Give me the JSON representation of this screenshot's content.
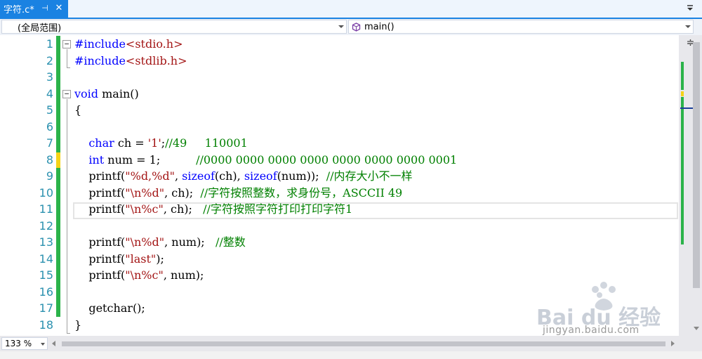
{
  "tab": {
    "title": "字符.c*",
    "pin_glyph": "⊣",
    "close_glyph": "✕"
  },
  "navbar": {
    "scope": "(全局范围)",
    "member": "main()"
  },
  "zoom": "133 %",
  "watermark": {
    "brand": "Bai du 经验",
    "url": "jingyan.baidu.com"
  },
  "lines": [
    {
      "n": "1",
      "segments": [
        {
          "t": "#include",
          "c": "kw"
        },
        {
          "t": "<stdio.h>",
          "c": "inc"
        }
      ]
    },
    {
      "n": "2",
      "segments": [
        {
          "t": "#include",
          "c": "kw"
        },
        {
          "t": "<stdlib.h>",
          "c": "inc"
        }
      ]
    },
    {
      "n": "3",
      "segments": []
    },
    {
      "n": "4",
      "segments": [
        {
          "t": "void",
          "c": "kw"
        },
        {
          "t": " main()",
          "c": "fn"
        }
      ]
    },
    {
      "n": "5",
      "segments": [
        {
          "t": "{",
          "c": "fn"
        }
      ]
    },
    {
      "n": "6",
      "segments": []
    },
    {
      "n": "7",
      "segments": [
        {
          "t": "    ",
          "c": "fn"
        },
        {
          "t": "char",
          "c": "kw"
        },
        {
          "t": " ch = ",
          "c": "fn"
        },
        {
          "t": "'1'",
          "c": "str"
        },
        {
          "t": ";",
          "c": "fn"
        },
        {
          "t": "//49     110001",
          "c": "cmt"
        }
      ]
    },
    {
      "n": "8",
      "segments": [
        {
          "t": "    ",
          "c": "fn"
        },
        {
          "t": "int",
          "c": "kw"
        },
        {
          "t": " num = 1;          ",
          "c": "fn"
        },
        {
          "t": "//0000 0000 0000 0000 0000 0000 0000 0001",
          "c": "cmt"
        }
      ]
    },
    {
      "n": "9",
      "segments": [
        {
          "t": "    printf(",
          "c": "fn"
        },
        {
          "t": "\"%d,%d\"",
          "c": "str"
        },
        {
          "t": ", ",
          "c": "fn"
        },
        {
          "t": "sizeof",
          "c": "kw"
        },
        {
          "t": "(ch), ",
          "c": "fn"
        },
        {
          "t": "sizeof",
          "c": "kw"
        },
        {
          "t": "(num));  ",
          "c": "fn"
        },
        {
          "t": "//内存大小不一样",
          "c": "cmt"
        }
      ]
    },
    {
      "n": "10",
      "segments": [
        {
          "t": "    printf(",
          "c": "fn"
        },
        {
          "t": "\"\\n%d\"",
          "c": "str"
        },
        {
          "t": ", ch);  ",
          "c": "fn"
        },
        {
          "t": "//字符按照整数，求身份号，ASCCII 49",
          "c": "cmt"
        }
      ]
    },
    {
      "n": "11",
      "segments": [
        {
          "t": "    printf(",
          "c": "fn"
        },
        {
          "t": "\"\\n%c\"",
          "c": "str"
        },
        {
          "t": ", ch);   ",
          "c": "fn"
        },
        {
          "t": "//字符按照字符打印打印字符1",
          "c": "cmt"
        }
      ]
    },
    {
      "n": "12",
      "segments": []
    },
    {
      "n": "13",
      "segments": [
        {
          "t": "    printf(",
          "c": "fn"
        },
        {
          "t": "\"\\n%d\"",
          "c": "str"
        },
        {
          "t": ", num);   ",
          "c": "fn"
        },
        {
          "t": "//整数",
          "c": "cmt"
        }
      ]
    },
    {
      "n": "14",
      "segments": [
        {
          "t": "    printf(",
          "c": "fn"
        },
        {
          "t": "\"last\"",
          "c": "str"
        },
        {
          "t": ");",
          "c": "fn"
        }
      ]
    },
    {
      "n": "15",
      "segments": [
        {
          "t": "    printf(",
          "c": "fn"
        },
        {
          "t": "\"\\n%c\"",
          "c": "str"
        },
        {
          "t": ", num);",
          "c": "fn"
        }
      ]
    },
    {
      "n": "16",
      "segments": []
    },
    {
      "n": "17",
      "segments": [
        {
          "t": "    getchar();",
          "c": "fn"
        }
      ]
    },
    {
      "n": "18",
      "segments": [
        {
          "t": "}",
          "c": "fn"
        }
      ]
    }
  ],
  "colors": {
    "accent": "#1a82e2",
    "keyword": "#0000ff",
    "string": "#a31515",
    "comment": "#008000",
    "line_number": "#2b91af",
    "changed": "#2bb34a",
    "unsaved": "#f5d318"
  },
  "icons": {
    "tab_dropdown": "chevron-down-icon",
    "member_icon": "method-cube-icon",
    "split": "split-window-icon"
  }
}
